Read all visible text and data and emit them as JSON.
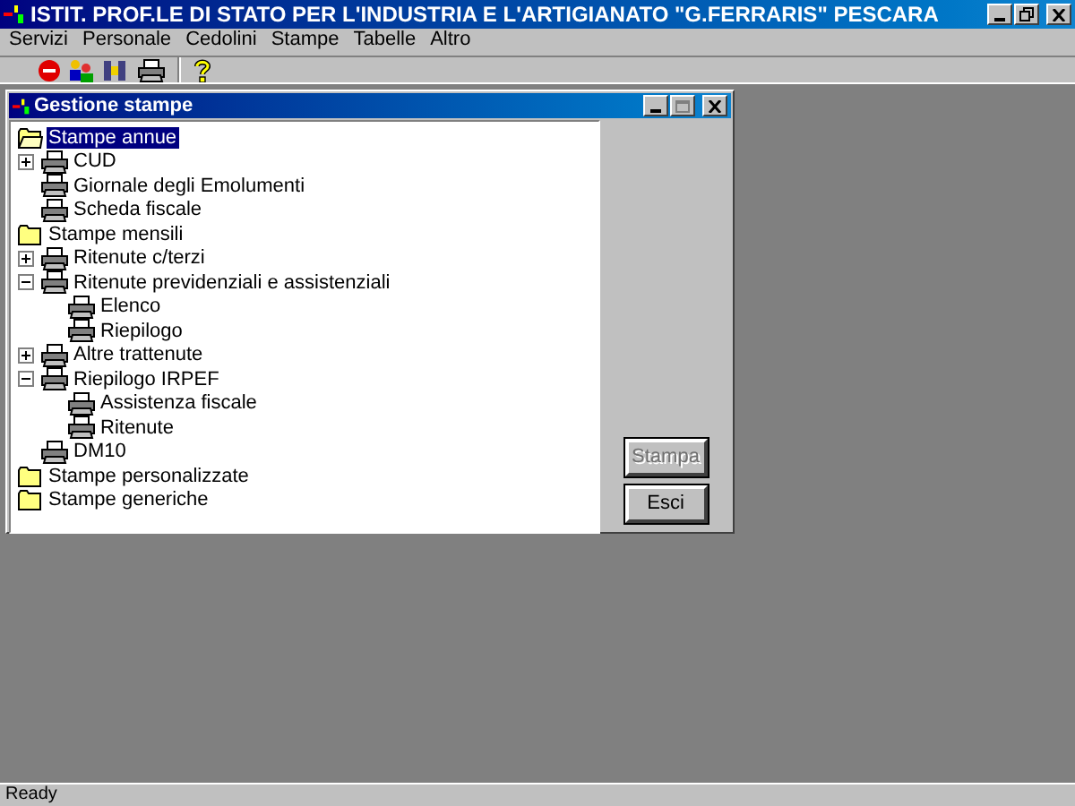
{
  "window": {
    "title": "ISTIT. PROF.LE DI STATO PER L'INDUSTRIA E L'ARTIGIANATO \"G.FERRARIS\" PESCARA"
  },
  "menu": [
    "Servizi",
    "Personale",
    "Cedolini",
    "Stampe",
    "Tabelle",
    "Altro"
  ],
  "child_window": {
    "title": "Gestione stampe",
    "tree": [
      {
        "label": "Stampe annue",
        "kind": "folder",
        "selected": true,
        "children": [
          {
            "label": "CUD",
            "kind": "printer",
            "selected": false,
            "expanded": false
          },
          {
            "label": "Giornale degli Emolumenti",
            "kind": "printer",
            "selected": false
          },
          {
            "label": "Scheda fiscale",
            "kind": "printer",
            "selected": false
          }
        ]
      },
      {
        "label": "Stampe mensili",
        "kind": "folder",
        "selected": false,
        "children": [
          {
            "label": "Ritenute c/terzi",
            "kind": "printer",
            "selected": false,
            "expanded": false
          },
          {
            "label": "Ritenute previdenziali e assistenziali",
            "kind": "printer",
            "selected": false,
            "expanded": true,
            "children": [
              {
                "label": "Elenco",
                "kind": "printer",
                "selected": false
              },
              {
                "label": "Riepilogo",
                "kind": "printer",
                "selected": false
              }
            ]
          },
          {
            "label": "Altre trattenute",
            "kind": "printer",
            "selected": false,
            "expanded": false
          },
          {
            "label": "Riepilogo IRPEF",
            "kind": "printer",
            "selected": false,
            "expanded": true,
            "children": [
              {
                "label": "Assistenza fiscale",
                "kind": "printer",
                "selected": false
              },
              {
                "label": "Ritenute",
                "kind": "printer",
                "selected": false
              }
            ]
          },
          {
            "label": "DM10",
            "kind": "printer",
            "selected": false
          }
        ]
      },
      {
        "label": "Stampe personalizzate",
        "kind": "folder",
        "selected": false
      },
      {
        "label": "Stampe generiche",
        "kind": "folder",
        "selected": false
      }
    ],
    "buttons": [
      {
        "label": "Stampa",
        "disabled": true
      },
      {
        "label": "Esci",
        "disabled": false
      }
    ]
  },
  "status_bar": "Ready"
}
